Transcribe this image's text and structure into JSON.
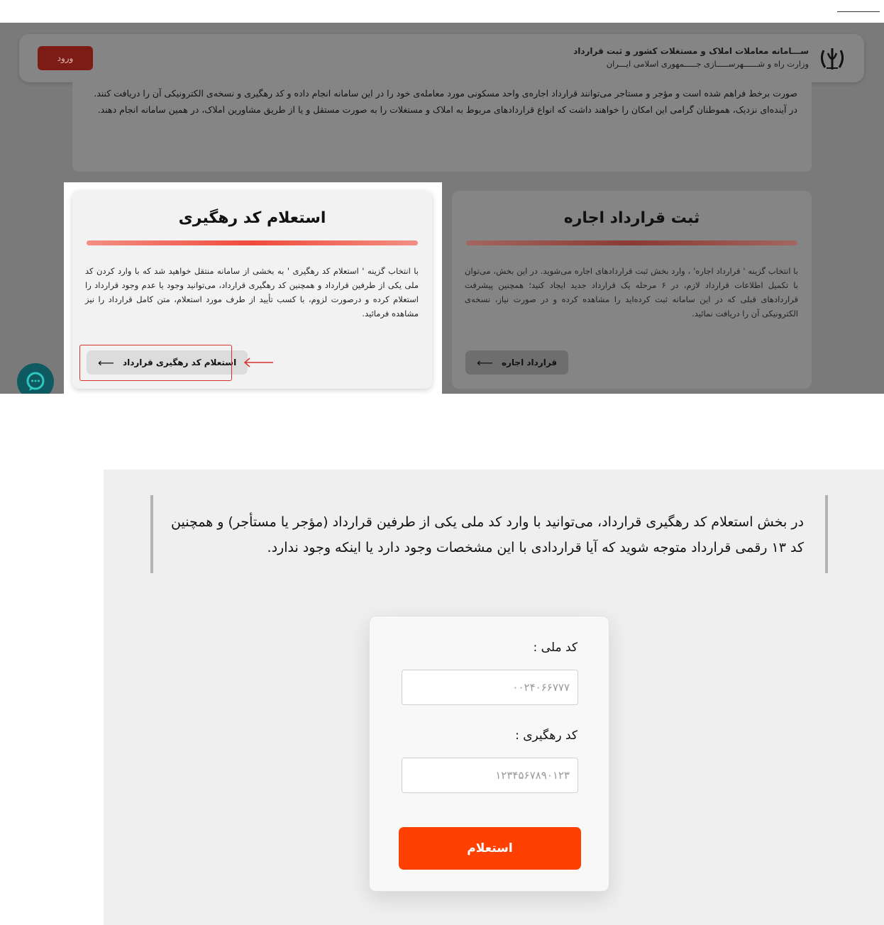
{
  "header": {
    "title": "ســـامانه معاملات املاک و مستغلات کشور و ثبت قرارداد",
    "subtitle": "وزارت راه و شــــــهرســـــازی جـــــمهوری اسلامی ایـــران",
    "login_label": "ورود",
    "emblem_icon": "iran-emblem"
  },
  "intro": {
    "text": "صورت برخط فراهم شده است و مؤجر و مستاجر می‌توانند قرارداد اجاره‌ی واحد مسکونی مورد معامله‌ی خود را در این سامانه انجام داده و کد رهگیری و نسخه‌ی الکترونیکی آن را دریافت کنند. در آینده‌ای نزدیک، هموطنان گرامی این امکان را خواهند داشت که انواع قراردادهای مربوط به املاک و مستغلات را به صورت مستقل و یا از طریق مشاورین املاک، در همین سامانه انجام دهند."
  },
  "cards": {
    "tracking": {
      "title": "استعلام کد رهگیری",
      "description": "با انتخاب گزینه ' استعلام کد رهگیری ' به بخشی از سامانه منتقل خواهید شد که با وارد کردن کد ملی یکی از طرفین قرارداد و همچنین کد رهگیری قرارداد، می‌توانید وجود یا عدم وجود قرارداد را استعلام کرده و درصورت لزوم، با کسب تأیید از طرف مورد استعلام، متن کامل قرارداد را نیز مشاهده فرمائید.",
      "button_label": "استعلام کد رهگیری قرارداد",
      "button_arrow": "⟵"
    },
    "lease": {
      "title": "ثبت قرارداد اجاره",
      "description": "با انتخاب گزینه ' قرارداد اجاره' ، وارد بخش ثبت قراردادهای اجاره می‌شوید. در این بخش، می‌توان با تکمیل اطلاعات قرارداد لازم، در ۶ مرحله یک قرارداد جدید ایجاد کنید؛ همچنین پیشرفت قراردادهای قبلی که در این سامانه ثبت کرده‌اید را مشاهده کرده و در صورت نیاز، نسخه‌ی الکترونیکی آن را دریافت نمائید.",
      "button_label": "قرارداد اجاره",
      "button_arrow": "⟵"
    }
  },
  "annotation": {
    "highlight_color": "#d8322a"
  },
  "chat": {
    "icon": "chat-bubble-icon"
  },
  "form_section": {
    "info_text": "در بخش استعلام کد رهگیری قرارداد، می‌توانید با وارد کد ملی یکی از طرفین قرارداد (مؤجر یا مستأجر) و همچنین کد ۱۳ رقمی قرارداد متوجه شوید که آیا قراردادی با این مشخصات وجود دارد یا اینکه وجود ندارد.",
    "national_code_label": "کد ملی :",
    "national_code_placeholder": "۰۰۲۴۰۶۶۷۷۷",
    "tracking_code_label": "کد رهگیری :",
    "tracking_code_placeholder": "۱۲۳۴۵۶۷۸۹۰۱۲۳",
    "submit_label": "استعلام",
    "submit_color": "#fe4103"
  }
}
